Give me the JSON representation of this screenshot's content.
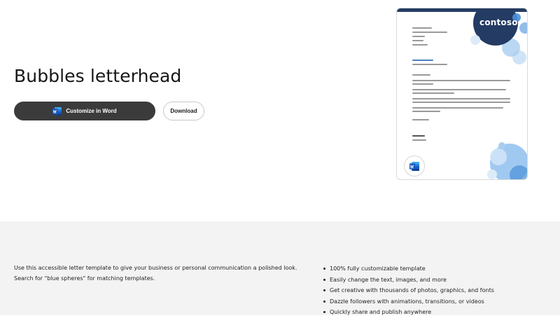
{
  "hero": {
    "title": "Bubbles letterhead",
    "customize_label": "Customize in Word",
    "download_label": "Download"
  },
  "preview": {
    "logo_text": "contoso",
    "brand_color": "#243b63",
    "accent_color": "#4a90d9"
  },
  "details": {
    "description": "Use this accessible letter template to give your business or personal communication a polished look. Search for \"blue spheres\" for matching templates.",
    "features": [
      "100% fully customizable template",
      "Easily change the text, images, and more",
      "Get creative with thousands of photos, graphics, and fonts",
      "Dazzle followers with animations, transitions, or videos",
      "Quickly share and publish anywhere"
    ]
  },
  "icons": {
    "word": "word-icon",
    "bullet": "bullet-icon"
  }
}
